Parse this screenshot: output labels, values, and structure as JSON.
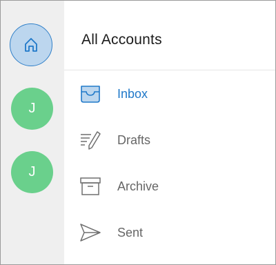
{
  "sidebar": {
    "home_icon": "home-icon",
    "accounts": [
      {
        "initial": "J",
        "color": "#6ad08c"
      },
      {
        "initial": "J",
        "color": "#6ad08c"
      }
    ]
  },
  "main": {
    "title": "All Accounts",
    "folders": [
      {
        "label": "Inbox",
        "icon": "inbox-icon",
        "selected": true
      },
      {
        "label": "Drafts",
        "icon": "drafts-icon",
        "selected": false
      },
      {
        "label": "Archive",
        "icon": "archive-icon",
        "selected": false
      },
      {
        "label": "Sent",
        "icon": "sent-icon",
        "selected": false
      }
    ]
  },
  "colors": {
    "accent": "#1f78c9",
    "home_fill": "#bcd6ee",
    "avatar": "#6ad08c",
    "rail_bg": "#efefef"
  }
}
